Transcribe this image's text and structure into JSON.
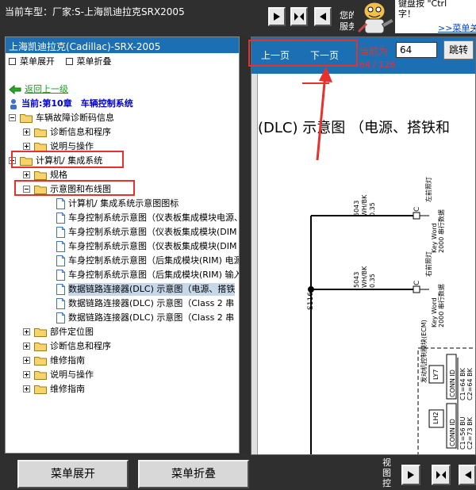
{
  "header": {
    "title": "当前车型：厂家:S-上海凯迪拉克SRX2005",
    "tip_side": "您的服务",
    "tip_line1": "键盘按 \"Ctrl",
    "tip_line2": "字！",
    "tip_link": ">>菜单关"
  },
  "left_panel": {
    "title": "上海凯迪拉克(Cadillac)-SRX-2005",
    "expand_label": "菜单展开",
    "collapse_label": "菜单折叠",
    "back_label": "返回上一级",
    "current_label": "当前:第10章　车辆控制系统",
    "tree": [
      "车辆故障诊断码信息",
      "诊断信息和程序",
      "说明与操作",
      "计算机/ 集成系统",
      "规格",
      "示意图和布线图",
      "计算机/ 集成系统示意图图标",
      "车身控制系统示意图（仪表板集成模块电源、",
      "车身控制系统示意图（仪表板集成模块(DIM",
      "车身控制系统示意图（仪表板集成模块(DIM",
      "车身控制系统示意图（后集成模块(RIM) 电源",
      "车身控制系统示意图（后集成模块(RIM) 输入",
      "数据链路连接器(DLC) 示意图（电源、搭铁",
      "数据链路连接器(DLC) 示意图（Class 2 串",
      "数据链路连接器(DLC) 示意图（Class 2 串",
      "部件定位图",
      "诊断信息和程序",
      "维修指南",
      "说明与操作",
      "维修指南"
    ]
  },
  "doc": {
    "prev_label": "上一页",
    "next_label": "下一页",
    "current_page_label": "当前为",
    "page_value": "64",
    "page_count": "64 / 126",
    "jump_label": "跳转",
    "title": "(DLC) 示意图 （电源、搭铁和",
    "wire1_num": "5043",
    "wire1_color": "WH/BK",
    "wire1_size": "0.35",
    "wire2_num": "5043",
    "wire2_color": "WH/BK",
    "wire2_size": "0.35",
    "splice": "S116",
    "c_label1": "C",
    "c_label2": "C",
    "conn1_label": "左前照灯",
    "conn1_text": "Key Word 2000 串行数据",
    "conn2_label": "右前照灯",
    "conn2_text": "Key Word 2000 串行数据",
    "ecm_label": "发动机控制模块(ECM)",
    "conn_id_a": "LY7",
    "conn_id_b": "LH2",
    "conn_id_label": "CONN ID",
    "conn_vals_a": "C1=64 BK C2=64 BK",
    "conn_vals_b": "C1=56 BU C2=73 BK"
  },
  "footer": {
    "expand_button": "菜单展开",
    "collapse_button": "菜单折叠",
    "view_label": "视图控"
  },
  "colors": {
    "accent_blue": "#1c6fb3",
    "highlight_red": "#e8302c",
    "link_green": "#1a9a1a"
  }
}
